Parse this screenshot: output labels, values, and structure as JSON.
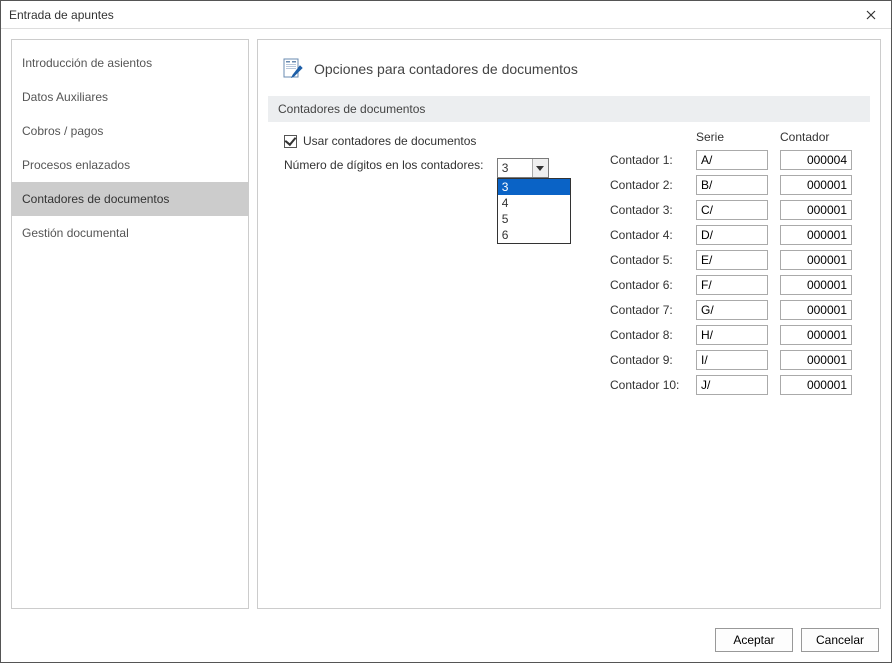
{
  "window": {
    "title": "Entrada de apuntes"
  },
  "sidebar": {
    "items": [
      {
        "label": "Introducción de asientos"
      },
      {
        "label": "Datos Auxiliares"
      },
      {
        "label": "Cobros / pagos"
      },
      {
        "label": "Procesos enlazados"
      },
      {
        "label": "Contadores de documentos"
      },
      {
        "label": "Gestión documental"
      }
    ],
    "selected": 4
  },
  "panel": {
    "title": "Opciones para contadores de documentos",
    "section": "Contadores de documentos",
    "use_counters_label": "Usar contadores de documentos",
    "digits_label": "Número de dígitos en los contadores:",
    "digits_value": "3",
    "digits_options": [
      "3",
      "4",
      "5",
      "6"
    ],
    "headers": {
      "serie": "Serie",
      "contador": "Contador"
    },
    "rows": [
      {
        "label": "Contador 1:",
        "serie": "A/",
        "contador": "000004"
      },
      {
        "label": "Contador 2:",
        "serie": "B/",
        "contador": "000001"
      },
      {
        "label": "Contador 3:",
        "serie": "C/",
        "contador": "000001"
      },
      {
        "label": "Contador 4:",
        "serie": "D/",
        "contador": "000001"
      },
      {
        "label": "Contador 5:",
        "serie": "E/",
        "contador": "000001"
      },
      {
        "label": "Contador 6:",
        "serie": "F/",
        "contador": "000001"
      },
      {
        "label": "Contador 7:",
        "serie": "G/",
        "contador": "000001"
      },
      {
        "label": "Contador 8:",
        "serie": "H/",
        "contador": "000001"
      },
      {
        "label": "Contador 9:",
        "serie": "I/",
        "contador": "000001"
      },
      {
        "label": "Contador 10:",
        "serie": "J/",
        "contador": "000001"
      }
    ]
  },
  "footer": {
    "ok": "Aceptar",
    "cancel": "Cancelar"
  }
}
